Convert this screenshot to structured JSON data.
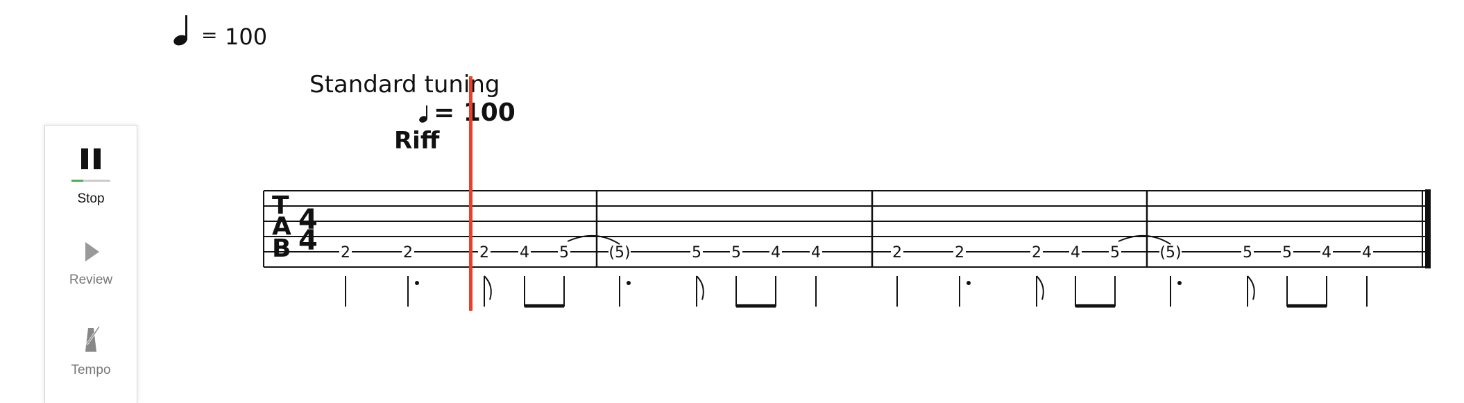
{
  "top_tempo": {
    "equals": "=",
    "bpm": "100",
    "note_icon": "quarter-note-icon"
  },
  "toolbar": {
    "stop": {
      "label": "Stop",
      "icon": "pause-icon",
      "progress": 0.3,
      "accent": "#4caf50"
    },
    "review": {
      "label": "Review",
      "icon": "play-icon"
    },
    "tempo": {
      "label": "Tempo",
      "icon": "metronome-icon"
    }
  },
  "score": {
    "tuning": "Standard tuning",
    "tempo_marking": "= 100",
    "section": "Riff",
    "clef": [
      "T",
      "A",
      "B"
    ],
    "time_signature": [
      "4",
      "4"
    ],
    "measures": [
      [
        "2",
        "2",
        "2",
        "4",
        "5"
      ],
      [
        "(5)",
        "5",
        "5",
        "4",
        "4"
      ],
      [
        "2",
        "2",
        "2",
        "4",
        "5"
      ],
      [
        "(5)",
        "5",
        "5",
        "4",
        "4"
      ]
    ],
    "cursor_color": "#e8402a"
  }
}
